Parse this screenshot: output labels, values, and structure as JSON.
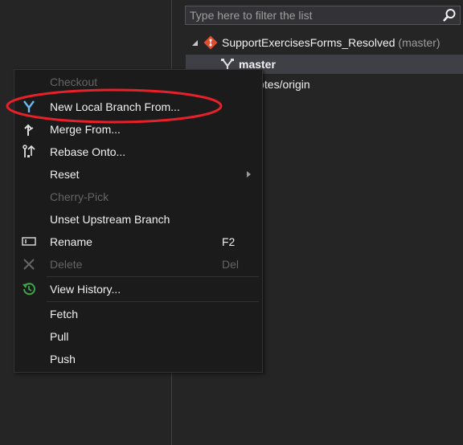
{
  "filter": {
    "placeholder": "Type here to filter the list",
    "icon": "search-icon"
  },
  "tree": {
    "repo_name": "SupportExercisesForms_Resolved",
    "repo_branch": "(master)",
    "selected_branch": "master",
    "remotes_label": "remotes/origin",
    "repo_icon_color": "#e04e2f",
    "selection_bg": "#3f3f46"
  },
  "menu": {
    "items": [
      {
        "label": "Checkout",
        "disabled": true
      },
      {
        "label": "New Local Branch From...",
        "icon": "new-branch-icon"
      },
      {
        "label": "Merge From...",
        "icon": "merge-icon"
      },
      {
        "label": "Rebase Onto...",
        "icon": "rebase-icon"
      },
      {
        "label": "Reset",
        "submenu": true
      },
      {
        "label": "Cherry-Pick",
        "disabled": true
      },
      {
        "label": "Unset Upstream Branch"
      },
      {
        "label": "Rename",
        "shortcut": "F2",
        "icon": "rename-icon"
      },
      {
        "label": "Delete",
        "shortcut": "Del",
        "disabled": true,
        "icon": "delete-icon"
      },
      {
        "label": "View History...",
        "icon": "history-icon"
      },
      {
        "label": "Fetch"
      },
      {
        "label": "Pull"
      },
      {
        "label": "Push"
      }
    ]
  },
  "colors": {
    "background": "#252526",
    "menu_background": "#1b1b1c",
    "annotation": "#e8202a",
    "history_icon": "#3ea54a",
    "new_branch_icon": "#6cb8f0"
  }
}
